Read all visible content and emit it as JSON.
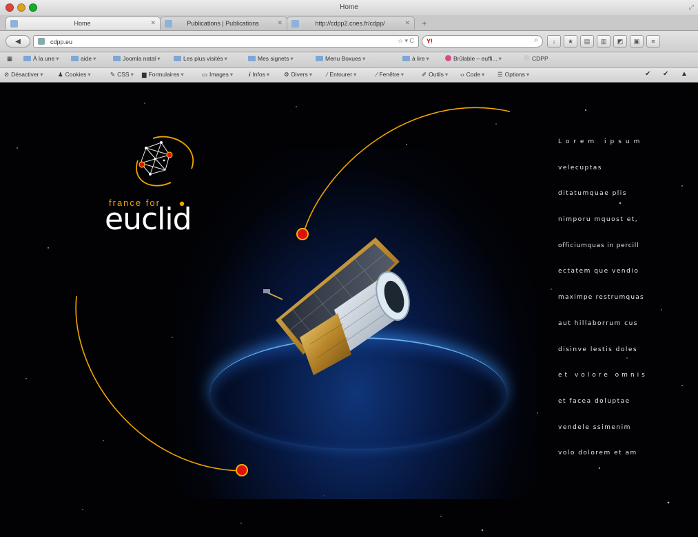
{
  "window": {
    "title": "Home"
  },
  "tabs": [
    {
      "label": "Home"
    },
    {
      "label": "Publications | Publications"
    },
    {
      "label": "http://cdpp2.cnes.fr/cdpp/"
    }
  ],
  "nav": {
    "url": "cdpp.eu",
    "search_engine": "Y!",
    "search_value": ""
  },
  "bookmarks": [
    {
      "label": "À la une"
    },
    {
      "label": "aide"
    },
    {
      "label": "Joomla natal"
    },
    {
      "label": "Les plus visités"
    },
    {
      "label": "Mes signets"
    },
    {
      "label": "Menu Boxues"
    },
    {
      "label": "à lire"
    },
    {
      "label": "Brûlable – euffi..."
    },
    {
      "label": "CDPP"
    }
  ],
  "webdev": [
    {
      "label": "Désactiver"
    },
    {
      "label": "Cookies"
    },
    {
      "label": "CSS"
    },
    {
      "label": "Formulaires"
    },
    {
      "label": "Images"
    },
    {
      "label": "Infos"
    },
    {
      "label": "Divers"
    },
    {
      "label": "Entourer"
    },
    {
      "label": "Fenêtre"
    },
    {
      "label": "Outils"
    },
    {
      "label": "Code"
    },
    {
      "label": "Options"
    }
  ],
  "logo": {
    "tagline": "france for",
    "wordmark": "euclid",
    "accent_color": "#f0a500"
  },
  "side_text": [
    "Lorem  ipsum",
    "velecuptas",
    "ditatumquae plis",
    "nimporu mquost et,",
    "officiumquas in percill",
    "ectatem que vendio",
    "maximpe restrumquas",
    "aut hillaborrum cus",
    "disinve lestis doles",
    "et volore omnis",
    "et facea doluptae",
    "vendele ssimenim",
    "volo dolorem et am"
  ],
  "colors": {
    "arc": "#f0a500",
    "dot_fill": "#e01010",
    "dot_stroke": "#f5b000",
    "page_bg": "#020204"
  }
}
